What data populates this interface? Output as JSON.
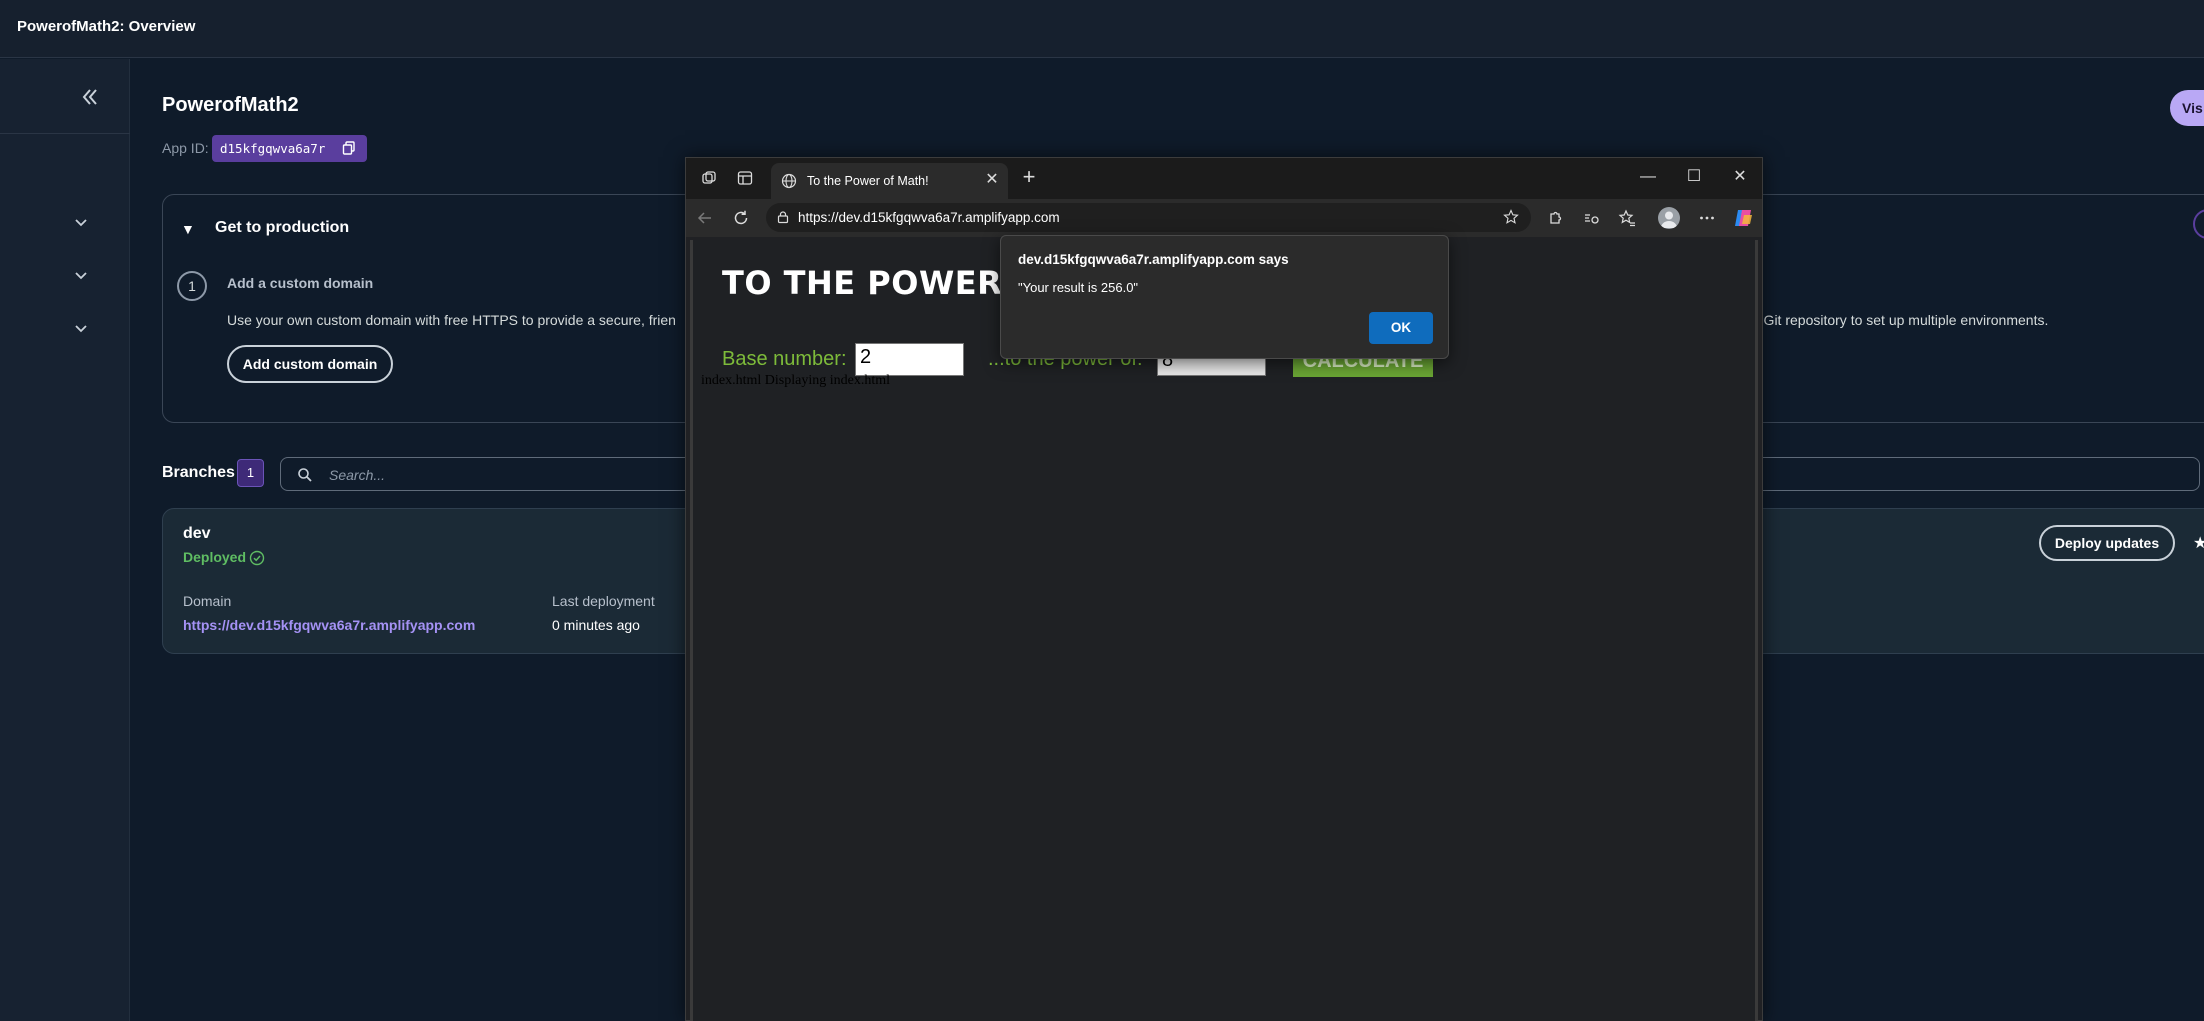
{
  "topbar": {
    "title": "PowerofMath2: Overview"
  },
  "app": {
    "name": "PowerofMath2",
    "app_id_label": "App ID:",
    "app_id": "d15kfgqwva6a7r",
    "visit_label": "Vis"
  },
  "production": {
    "title": "Get to production",
    "step_number": "1",
    "step_title": "Add a custom domain",
    "step_desc": "Use your own custom domain with free HTTPS to provide a secure, frien",
    "step_desc_tail": "r Git repository to set up multiple environments.",
    "add_domain_label": "Add custom domain"
  },
  "branches": {
    "label": "Branches",
    "count": "1",
    "search_placeholder": "Search...",
    "card": {
      "name": "dev",
      "status": "Deployed",
      "domain_label": "Domain",
      "domain_url": "https://dev.d15kfgqwva6a7r.amplifyapp.com",
      "last_deployment_label": "Last deployment",
      "last_deployment_value": "0 minutes ago",
      "deploy_label": "Deploy updates"
    }
  },
  "browser": {
    "tab_title": "To the Power of Math!",
    "url": "https://dev.d15kfgqwva6a7r.amplifyapp.com",
    "page": {
      "heading": "TO THE POWER OF",
      "base_label": "Base number:",
      "base_value": "2",
      "power_label": "...to the power of:",
      "power_value": "8",
      "calculate_label": "CALCULATE",
      "footer": "index.html Displaying index.html"
    }
  },
  "alert": {
    "title": "dev.d15kfgqwva6a7r.amplifyapp.com says",
    "message": "\"Your result is 256.0\"",
    "ok_label": "OK"
  },
  "colors": {
    "accent_purple": "#5a3e9e",
    "success_green": "#5fbd63",
    "link_purple": "#a592f5",
    "calc_green": "#6aa534",
    "ok_blue": "#0f6cbd"
  }
}
